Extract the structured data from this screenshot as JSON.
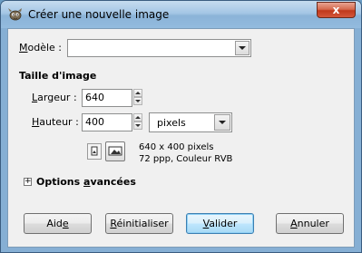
{
  "window": {
    "title": "Créer une nouvelle image",
    "close_label": "x"
  },
  "template": {
    "label_pre": "",
    "label_access": "M",
    "label_post": "odèle :",
    "value": ""
  },
  "image_size": {
    "section_title": "Taille d'image",
    "width": {
      "label_access": "L",
      "label_post": "argeur :",
      "value": "640"
    },
    "height": {
      "label_access": "H",
      "label_post": "auteur :",
      "value": "400"
    },
    "unit": "pixels",
    "info_line1": "640 x 400 pixels",
    "info_line2": "72 ppp, Couleur RVB"
  },
  "advanced": {
    "expander_symbol": "+",
    "label_pre": "Options ",
    "label_access": "a",
    "label_post": "vancées"
  },
  "buttons": {
    "help": {
      "pre": "Aid",
      "access": "e",
      "post": ""
    },
    "reset": {
      "pre": "",
      "access": "R",
      "post": "éinitialiser"
    },
    "ok": {
      "pre": "",
      "access": "V",
      "post": "alider"
    },
    "cancel": {
      "pre": "",
      "access": "A",
      "post": "nnuler"
    }
  },
  "colors": {
    "title_bar": "#a4c6e5",
    "close_button": "#c0391c",
    "default_button_border": "#3c7fb1"
  }
}
